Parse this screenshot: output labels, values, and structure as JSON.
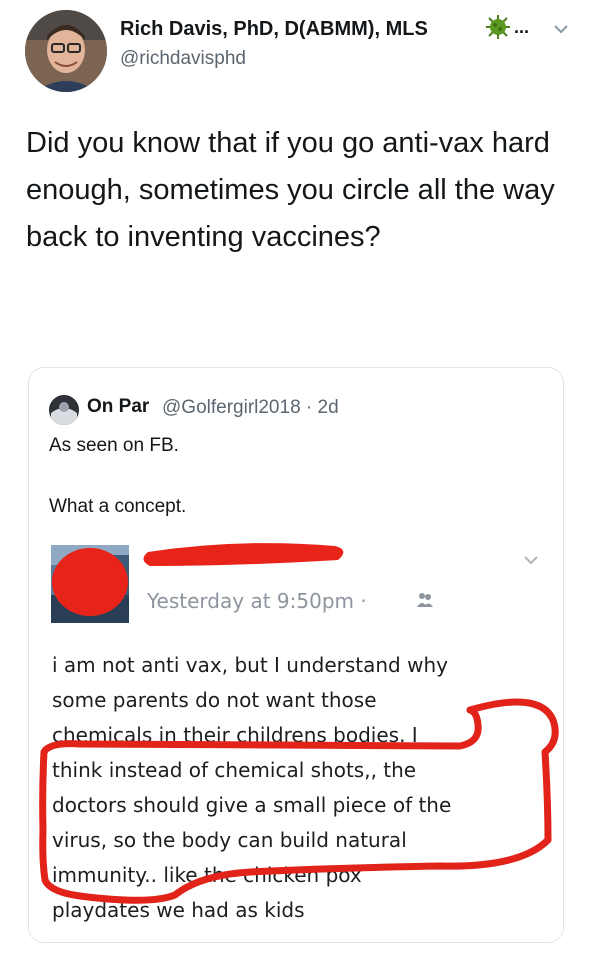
{
  "tweet": {
    "author": {
      "name": "Rich Davis, PhD, D(ABMM), MLS",
      "handle": "@richdavisphd",
      "more": "..."
    },
    "text": "Did you know that if you go anti-vax hard enough, sometimes you circle all the way back to inventing vaccines?"
  },
  "quote": {
    "name": "On Par",
    "meta": "@Golfergirl2018 · 2d",
    "line1": "As seen on FB.",
    "line2": "What a concept.",
    "fb_post": {
      "time": "Yesterday at 9:50pm ·",
      "lines": [
        "i am not anti vax, but I understand why",
        "some parents do not want those",
        "chemicals in their childrens bodies. I",
        "think instead of chemical shots,, the",
        "doctors should give a small piece of the",
        "virus, so the body can build natural",
        "immunity.. like the chicken pox",
        "playdates we had as kids"
      ]
    }
  },
  "colors": {
    "text": "#14171a",
    "secondary": "#5b6670",
    "border": "#e1e5ea",
    "redaction": "#e8231a",
    "fb_time": "#8d949e"
  }
}
